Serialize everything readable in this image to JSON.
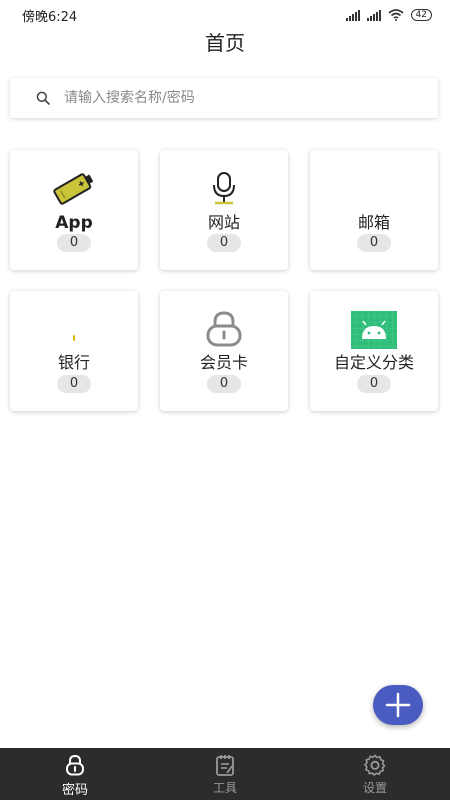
{
  "status_bar": {
    "time": "傍晚6:24",
    "battery": "42"
  },
  "header": {
    "title": "首页"
  },
  "search": {
    "placeholder": "请输入搜索名称/密码"
  },
  "categories": [
    {
      "label": "App",
      "count": "0",
      "icon": "battery-icon"
    },
    {
      "label": "网站",
      "count": "0",
      "icon": "microphone-icon"
    },
    {
      "label": "邮箱",
      "count": "0",
      "icon": "none"
    },
    {
      "label": "银行",
      "count": "0",
      "icon": "small-dot-icon"
    },
    {
      "label": "会员卡",
      "count": "0",
      "icon": "lock-icon"
    },
    {
      "label": "自定义分类",
      "count": "0",
      "icon": "android-icon"
    }
  ],
  "fab": {
    "icon": "plus-icon"
  },
  "bottom_nav": [
    {
      "label": "密码",
      "icon": "lock-icon",
      "active": true
    },
    {
      "label": "工具",
      "icon": "notepad-icon",
      "active": false
    },
    {
      "label": "设置",
      "icon": "gear-icon",
      "active": false
    }
  ],
  "colors": {
    "accent": "#4a5cc2",
    "nav_background": "#2c2c2c",
    "app_icon_yellow": "#c9c43a",
    "android_green": "#3ddc84"
  }
}
